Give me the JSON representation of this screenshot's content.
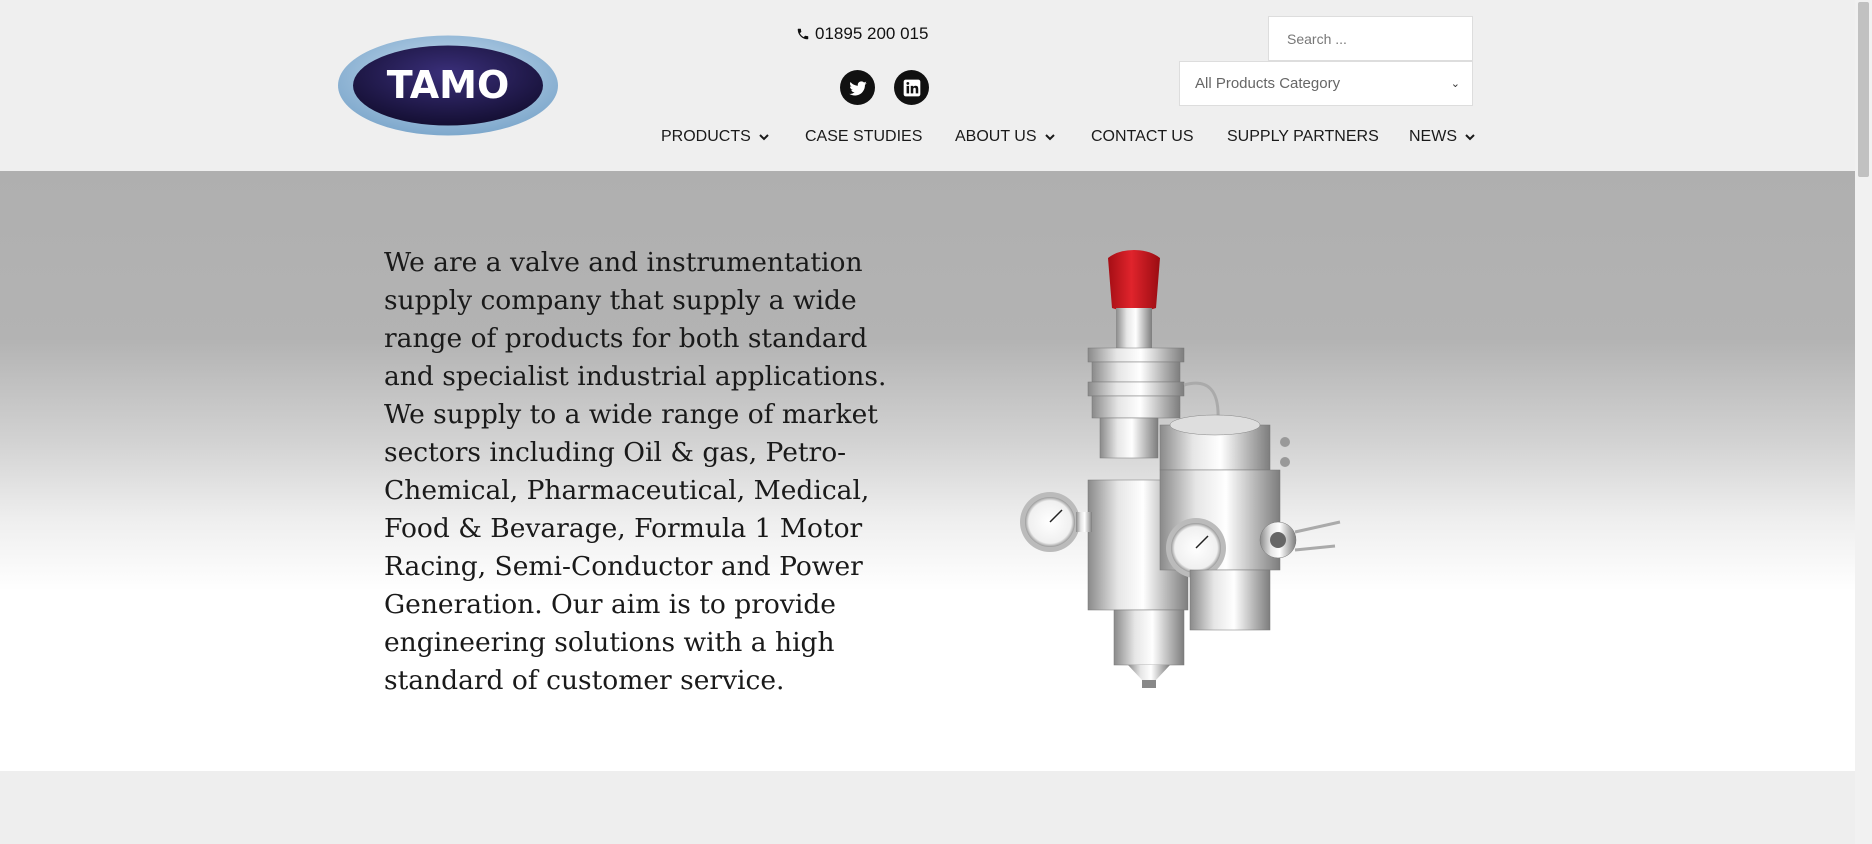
{
  "header": {
    "logo_text": "TAMO",
    "phone": "01895 200 015",
    "search": {
      "placeholder": "Search ..."
    },
    "category_select": {
      "selected": "All Products Category"
    },
    "social": [
      "twitter-icon",
      "linkedin-icon"
    ]
  },
  "nav": {
    "items": [
      {
        "label": "PRODUCTS",
        "has_dropdown": true
      },
      {
        "label": "CASE STUDIES",
        "has_dropdown": false
      },
      {
        "label": "ABOUT US",
        "has_dropdown": true
      },
      {
        "label": "CONTACT US",
        "has_dropdown": false
      },
      {
        "label": "SUPPLY PARTNERS",
        "has_dropdown": false
      },
      {
        "label": "NEWS",
        "has_dropdown": true
      }
    ]
  },
  "hero": {
    "text": "We are a valve and instrumentation supply company that supply a wide range of products for both standard and specialist industrial applications. We supply to a wide range of market sectors including Oil & gas, Petro-Chemical, Pharmaceutical, Medical, Food & Bevarage, Formula 1 Motor Racing, Semi-Conductor and Power Generation. Our aim is to provide engineering solutions with a high standard of customer service.",
    "image": "valve-assembly-image"
  },
  "colors": {
    "logo_dark": "#1e1848",
    "logo_ring": "#8fb6d6",
    "valve_cap": "#d4121c",
    "page_bg": "#eeeeee"
  }
}
